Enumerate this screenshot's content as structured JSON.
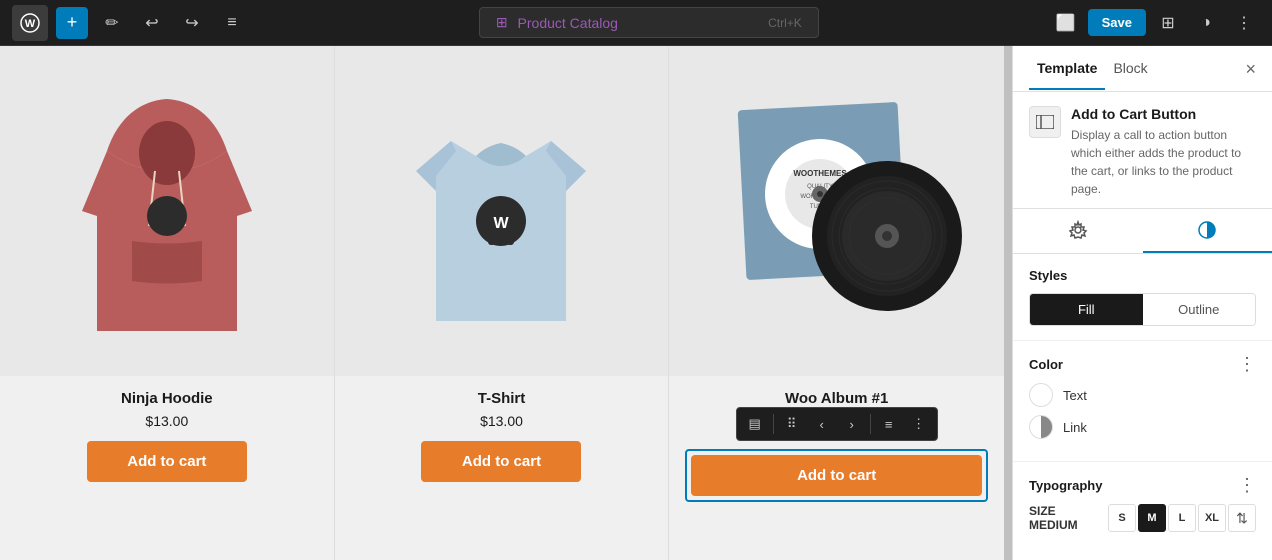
{
  "topbar": {
    "wp_logo": "W",
    "add_btn": "+",
    "pencil_btn": "✏",
    "undo_btn": "↩",
    "redo_btn": "↪",
    "list_btn": "≡",
    "search_text": "Product Catalog",
    "search_shortcut": "Ctrl+K",
    "save_label": "Save"
  },
  "products": [
    {
      "id": "ninja-hoodie",
      "title": "Ninja Hoodie",
      "price": "$13.00",
      "btn_label": "Add to cart",
      "selected": false
    },
    {
      "id": "t-shirt",
      "title": "T-Shirt",
      "price": "$13.00",
      "btn_label": "Add to cart",
      "selected": false
    },
    {
      "id": "woo-album",
      "title": "Woo Album #1",
      "price": "",
      "btn_label": "Add to cart",
      "selected": true
    }
  ],
  "sidebar": {
    "tab_template": "Template",
    "tab_block": "Block",
    "block_name": "Add to Cart Button",
    "block_desc": "Display a call to action button which either adds the product to the cart, or links to the product page.",
    "settings_icon": "⚙",
    "styles_icon": "◑",
    "styles_label": "Styles",
    "fill_label": "Fill",
    "outline_label": "Outline",
    "color_label": "Color",
    "text_label": "Text",
    "link_label": "Link",
    "typography_label": "Typography",
    "size_label": "SIZE",
    "size_value": "MEDIUM",
    "size_options": [
      "S",
      "M",
      "L",
      "XL"
    ]
  },
  "block_toolbar": {
    "layout_icon": "▤",
    "drag_icon": "⠿",
    "left_arrow": "‹",
    "right_arrow": "›",
    "align_icon": "≡",
    "more_icon": "⋮"
  }
}
